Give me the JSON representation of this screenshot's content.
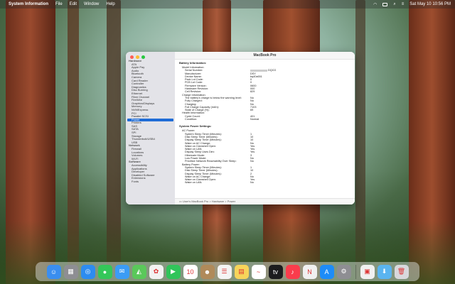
{
  "menubar": {
    "app_name": "System Information",
    "items": [
      "File",
      "Edit",
      "Window",
      "Help"
    ],
    "datetime": "Sat May 10  10:56 PM"
  },
  "window": {
    "title": "MacBook Pro",
    "path": "User's MacBook Pro > Hardware > Power"
  },
  "sidebar": {
    "items": [
      {
        "label": "Hardware",
        "group": true
      },
      {
        "label": "ATA"
      },
      {
        "label": "Apple Pay"
      },
      {
        "label": "Audio"
      },
      {
        "label": "Bluetooth"
      },
      {
        "label": "Camera"
      },
      {
        "label": "Card Reader"
      },
      {
        "label": "Controller"
      },
      {
        "label": "Diagnostics"
      },
      {
        "label": "Disc Burning"
      },
      {
        "label": "Ethernet"
      },
      {
        "label": "Fibre Channel"
      },
      {
        "label": "FireWire"
      },
      {
        "label": "Graphics/Displays"
      },
      {
        "label": "Memory"
      },
      {
        "label": "NVMExpress"
      },
      {
        "label": "PCI"
      },
      {
        "label": "Parallel SCSI"
      },
      {
        "label": "Power",
        "selected": true
      },
      {
        "label": "Printers"
      },
      {
        "label": "SAS"
      },
      {
        "label": "SATA"
      },
      {
        "label": "SPI"
      },
      {
        "label": "Storage"
      },
      {
        "label": "Thunderbolt/USB4"
      },
      {
        "label": "USB"
      },
      {
        "label": "Network",
        "group": true
      },
      {
        "label": "Firewall"
      },
      {
        "label": "Locations"
      },
      {
        "label": "Volumes"
      },
      {
        "label": "Wi-Fi"
      },
      {
        "label": "Software",
        "group": true
      },
      {
        "label": "Accessibility"
      },
      {
        "label": "Applications"
      },
      {
        "label": "Developer"
      },
      {
        "label": "Disabled Software"
      },
      {
        "label": "Extensions"
      },
      {
        "label": "Fonts"
      }
    ]
  },
  "detail": {
    "battery_header": "Battery Information:",
    "battery_rows": [
      {
        "k": "Model Information:",
        "v": "",
        "lvl": 1
      },
      {
        "k": "Serial Number:",
        "v": "DQCG",
        "lvl": 2,
        "redacted": true
      },
      {
        "k": "Manufacturer:",
        "v": "DSY",
        "lvl": 2
      },
      {
        "k": "Device Name:",
        "v": "bq40z651",
        "lvl": 2
      },
      {
        "k": "Pack Lot Code:",
        "v": "0",
        "lvl": 2
      },
      {
        "k": "PCB Lot Code:",
        "v": "0",
        "lvl": 2
      },
      {
        "k": "Firmware Version:",
        "v": "0600",
        "lvl": 2
      },
      {
        "k": "Hardware Revision:",
        "v": "000",
        "lvl": 2
      },
      {
        "k": "Cell Revision:",
        "v": "829",
        "lvl": 2
      },
      {
        "k": "Charge Information:",
        "v": "",
        "lvl": 1
      },
      {
        "k": "The battery's charge is below the warning level:",
        "v": "No",
        "lvl": 2
      },
      {
        "k": "Fully Charged:",
        "v": "No",
        "lvl": 2
      },
      {
        "k": "Charging:",
        "v": "No",
        "lvl": 2
      },
      {
        "k": "Full Charge Capacity (mAh):",
        "v": "7103",
        "lvl": 2
      },
      {
        "k": "State of Charge (%):",
        "v": "69",
        "lvl": 2
      },
      {
        "k": "Health Information:",
        "v": "",
        "lvl": 1
      },
      {
        "k": "Cycle Count:",
        "v": "401",
        "lvl": 2
      },
      {
        "k": "Condition:",
        "v": "Normal",
        "lvl": 2
      }
    ],
    "power_header": "System Power Settings:",
    "power_rows": [
      {
        "k": "AC Power:",
        "v": "",
        "lvl": 1
      },
      {
        "k": "System Sleep Timer (Minutes):",
        "v": "1",
        "lvl": 2
      },
      {
        "k": "Disk Sleep Timer (Minutes):",
        "v": "10",
        "lvl": 2
      },
      {
        "k": "Display Sleep Timer (Minutes):",
        "v": "10",
        "lvl": 2
      },
      {
        "k": "Wake on AC Change:",
        "v": "No",
        "lvl": 2
      },
      {
        "k": "Wake on Clamshell Open:",
        "v": "Yes",
        "lvl": 2
      },
      {
        "k": "Wake on LAN:",
        "v": "Yes",
        "lvl": 2
      },
      {
        "k": "Display Sleep Uses Dim:",
        "v": "Yes",
        "lvl": 2
      },
      {
        "k": "Hibernate Mode:",
        "v": "3",
        "lvl": 2
      },
      {
        "k": "Low Power Mode:",
        "v": "No",
        "lvl": 2
      },
      {
        "k": "Prioritize Network Reachability Over Sleep:",
        "v": "No",
        "lvl": 2
      },
      {
        "k": "Battery Power:",
        "v": "",
        "lvl": 1
      },
      {
        "k": "System Sleep Timer (Minutes):",
        "v": "1",
        "lvl": 2
      },
      {
        "k": "Disk Sleep Timer (Minutes):",
        "v": "10",
        "lvl": 2
      },
      {
        "k": "Display Sleep Timer (Minutes):",
        "v": "2",
        "lvl": 2
      },
      {
        "k": "Wake on AC Change:",
        "v": "No",
        "lvl": 2
      },
      {
        "k": "Wake on Clamshell Open:",
        "v": "Yes",
        "lvl": 2
      },
      {
        "k": "Wake on LAN:",
        "v": "No",
        "lvl": 2
      }
    ]
  },
  "dock": {
    "apps": [
      {
        "name": "finder-icon",
        "color": "#3a8ef0",
        "glyph": "☺"
      },
      {
        "name": "launchpad-icon",
        "color": "#8e8e93",
        "glyph": "▦"
      },
      {
        "name": "safari-icon",
        "color": "#2d8cf0",
        "glyph": "◎"
      },
      {
        "name": "messages-icon",
        "color": "#34c759",
        "glyph": "●"
      },
      {
        "name": "mail-icon",
        "color": "#3b9cf5",
        "glyph": "✉"
      },
      {
        "name": "maps-icon",
        "color": "#5ac85a",
        "glyph": "◭"
      },
      {
        "name": "photos-icon",
        "color": "#f2f2f2",
        "glyph": "✿"
      },
      {
        "name": "facetime-icon",
        "color": "#30c45a",
        "glyph": "▶"
      },
      {
        "name": "calendar-icon",
        "color": "#ffffff",
        "glyph": "10"
      },
      {
        "name": "contacts-icon",
        "color": "#b08a5a",
        "glyph": "☻"
      },
      {
        "name": "reminders-icon",
        "color": "#f4f4f4",
        "glyph": "☰"
      },
      {
        "name": "notes-icon",
        "color": "#f7d45a",
        "glyph": "▤"
      },
      {
        "name": "freeform-icon",
        "color": "#ffffff",
        "glyph": "~"
      },
      {
        "name": "tv-icon",
        "color": "#1c1c1e",
        "glyph": "tv"
      },
      {
        "name": "music-icon",
        "color": "#fa3c4c",
        "glyph": "♪"
      },
      {
        "name": "news-icon",
        "color": "#f0f0f0",
        "glyph": "N"
      },
      {
        "name": "app-store-icon",
        "color": "#1d8cf8",
        "glyph": "A"
      },
      {
        "name": "system-settings-icon",
        "color": "#8e8e93",
        "glyph": "⚙"
      },
      {
        "name": "separator",
        "sep": true
      },
      {
        "name": "system-information-icon",
        "color": "#f0f0f0",
        "glyph": "▣"
      },
      {
        "name": "downloads-folder-icon",
        "color": "#5ab4f0",
        "glyph": "⬇"
      },
      {
        "name": "trash-icon",
        "color": "#d8d8dc",
        "glyph": "🗑"
      }
    ]
  }
}
